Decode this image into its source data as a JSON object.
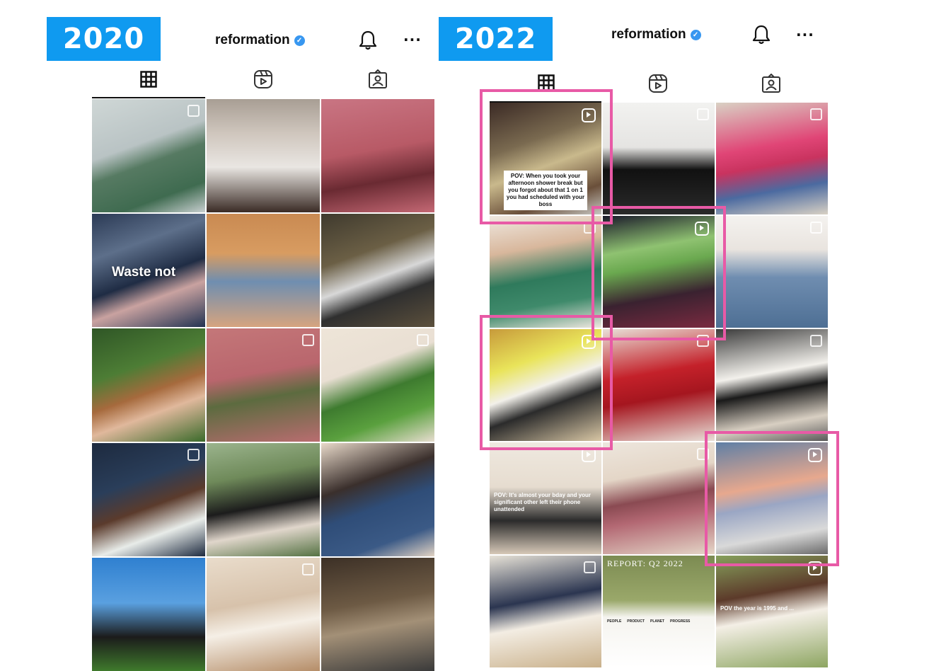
{
  "panels": {
    "left": {
      "year": "2020",
      "account": "reformation",
      "tiles": [
        {
          "bg": "linear-gradient(160deg,#cfd7d6 0%,#b9c3c4 40%,#567a62 55%,#3f6b50 80%,#c8cfd0 100%)",
          "badge": "multi"
        },
        {
          "bg": "linear-gradient(180deg,#a89e94 0%,#cfc6bd 30%,#e9e6e2 60%,#3a2b25 100%)",
          "badge": "none"
        },
        {
          "bg": "linear-gradient(170deg,#c97583 0%,#b85a66 45%,#6a2a32 70%,#c46874 100%)",
          "badge": "none"
        },
        {
          "bg": "linear-gradient(160deg,#2b3a55 0%,#5d6f8a 30%,#1f2c44 55%,#c9a2a0 70%,#233352 100%)",
          "badge": "none",
          "text": "Waste not"
        },
        {
          "bg": "linear-gradient(180deg,#c98a52 0%,#d89c61 35%,#6f8eb0 60%,#d6a47f 100%)",
          "badge": "none"
        },
        {
          "bg": "linear-gradient(160deg,#3f3a2e 0%,#6b5f45 35%,#d8d8d8 55%,#2f2f2f 70%,#5c503c 100%)",
          "badge": "none"
        },
        {
          "bg": "linear-gradient(160deg,#2f5626 0%,#4d7d35 35%,#a66a3d 55%,#e0b89c 70%,#3a6a2a 100%)",
          "badge": "none"
        },
        {
          "bg": "linear-gradient(170deg,#c47779 0%,#b9666d 40%,#5c6b3f 60%,#b96d70 100%)",
          "badge": "multi"
        },
        {
          "bg": "linear-gradient(160deg,#eee5d8 0%,#e9dfd3 35%,#3e7b2f 55%,#5aa03e 75%,#e8ddd0 100%)",
          "badge": "multi"
        },
        {
          "bg": "linear-gradient(160deg,#1d2a3f 0%,#2a3e5a 35%,#5b3b2c 55%,#e8ece9 75%,#1d2a3f 100%)",
          "badge": "multi"
        },
        {
          "bg": "linear-gradient(170deg,#9bb48d 0%,#6f8a5a 30%,#1c1c1c 55%,#e0d6cb 75%,#557243 100%)",
          "badge": "none"
        },
        {
          "bg": "linear-gradient(160deg,#e8d9c9 0%,#3a2f2c 35%,#2f4d78 55%,#3b5a86 80%,#e3d4c4 100%)",
          "badge": "none"
        },
        {
          "bg": "linear-gradient(180deg,#2f80d0 0%,#5aa0e0 40%,#1b1b1b 70%,#3f7a2c 100%)",
          "badge": "none"
        },
        {
          "bg": "linear-gradient(170deg,#e9dccb 0%,#d7c2ab 40%,#f5efe6 60%,#b58d68 100%)",
          "badge": "multi"
        },
        {
          "bg": "linear-gradient(170deg,#3c3026 0%,#6d5a44 40%,#a39077 60%,#3a3a3a 100%)",
          "badge": "none"
        }
      ]
    },
    "right": {
      "year": "2022",
      "account": "reformation",
      "tiles": [
        {
          "bg": "linear-gradient(160deg,#3b2a25 0%,#7a6a50 35%,#c9b98c 55%,#6a4f3a 80%,#c7c7c2 100%)",
          "badge": "reel",
          "caption": "POV: When you took your afternoon shower break but you forgot about that 1 on 1 you had scheduled with your boss",
          "captionStyle": "boxed"
        },
        {
          "bg": "linear-gradient(180deg,#f2f2f0 0%,#e5e4e2 40%,#111 60%,#2a2a2a 100%)",
          "badge": "multi"
        },
        {
          "bg": "linear-gradient(170deg,#d9d1c4 0%,#e04576 40%,#c9335f 55%,#4b6aa0 75%,#d9d1c4 100%)",
          "badge": "multi"
        },
        {
          "bg": "linear-gradient(170deg,#efe8e0 0%,#d8b79c 30%,#2f7a5c 55%,#3f8a6b 75%,#efe8e0 100%)",
          "badge": "multi"
        },
        {
          "bg": "linear-gradient(170deg,#1a1a2a 0%,#8fc271 30%,#6aa84f 45%,#3a2230 70%,#7a2a40 100%)",
          "badge": "reel"
        },
        {
          "bg": "linear-gradient(180deg,#f4f2ef 0%,#e9e4df 30%,#6f8db0 55%,#4e6f94 100%)",
          "badge": "multi"
        },
        {
          "bg": "linear-gradient(160deg,#c79a3b 0%,#e9e45a 30%,#f2f0ea 50%,#2b2b2b 65%,#d9c7a5 100%)",
          "badge": "reel"
        },
        {
          "bg": "linear-gradient(170deg,#e8e0d8 0%,#c4212a 40%,#a5161f 60%,#e8e0d8 100%)",
          "badge": "multi"
        },
        {
          "bg": "linear-gradient(170deg,#3b3b3b 0%,#f3f1ec 40%,#1a1a1a 55%,#d8cfc2 80%,#5a5a5a 100%)",
          "badge": "multi"
        },
        {
          "bg": "linear-gradient(180deg,#efe9e0 0%,#e6dccf 40%,#2b2b2b 70%,#d7c9b8 100%)",
          "badge": "reel",
          "caption": "POV: It's almost your bday and your significant other left their phone unattended",
          "captionStyle": "plain"
        },
        {
          "bg": "linear-gradient(170deg,#ede6dd 0%,#e4d6c7 30%,#8a4a52 50%,#b36873 65%,#e4d6c7 100%)",
          "badge": "multi"
        },
        {
          "bg": "linear-gradient(170deg,#5f7fa5 0%,#e7a88e 40%,#9aa6c4 55%,#d9d9d9 80%,#6a6a6a 100%)",
          "badge": "reel"
        },
        {
          "bg": "linear-gradient(170deg,#e7e2d7 0%,#2b3550 40%,#f3ede3 60%,#c9b08a 100%)",
          "badge": "multi"
        },
        {
          "bg": "linear-gradient(180deg,#7c8b52 0%,#9aa86a 40%,#f5f4ef 55%,#ffffff 100%)",
          "badge": "none",
          "report": "REPORT: Q2 2022",
          "reportCols": [
            "PEOPLE",
            "PRODUCT",
            "PLANET",
            "PROGRESS"
          ]
        },
        {
          "bg": "linear-gradient(170deg,#86a05c 0%,#5c3a2a 35%,#f4efe6 55%,#8da561 100%)",
          "badge": "reel",
          "caption": "POV the year is 1995 and ...",
          "captionStyle": "plain"
        }
      ]
    }
  },
  "colors": {
    "year_badge": "#0f9af0",
    "highlight": "#e85aa6",
    "verified": "#3897f0"
  }
}
